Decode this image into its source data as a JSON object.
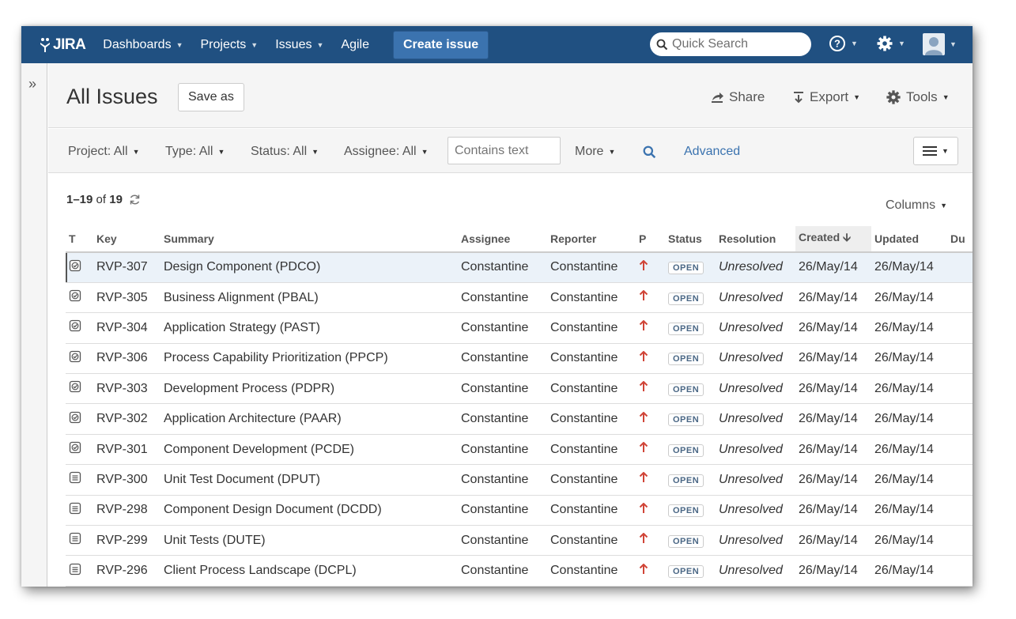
{
  "topnav": {
    "logo": "JIRA",
    "items": [
      "Dashboards",
      "Projects",
      "Issues",
      "Agile"
    ],
    "create_label": "Create issue",
    "search_placeholder": "Quick Search",
    "accent": "#205081"
  },
  "page": {
    "title": "All Issues",
    "save_as": "Save as",
    "share": "Share",
    "export": "Export",
    "tools": "Tools"
  },
  "filters": {
    "project": "Project: All",
    "type": "Type: All",
    "status": "Status: All",
    "assignee": "Assignee: All",
    "contains_placeholder": "Contains text",
    "more": "More",
    "advanced": "Advanced"
  },
  "results": {
    "range": "1–19",
    "of_label": "of",
    "total": "19",
    "columns_label": "Columns"
  },
  "table": {
    "headers": {
      "t": "T",
      "key": "Key",
      "summary": "Summary",
      "assignee": "Assignee",
      "reporter": "Reporter",
      "p": "P",
      "status": "Status",
      "resolution": "Resolution",
      "created": "Created",
      "updated": "Updated",
      "due": "Du"
    },
    "rows": [
      {
        "type": "check-icon",
        "key": "RVP-307",
        "summary": "Design Component (PDCO)",
        "assignee": "Constantine",
        "reporter": "Constantine",
        "status": "OPEN",
        "resolution": "Unresolved",
        "created": "26/May/14",
        "updated": "26/May/14"
      },
      {
        "type": "check-icon",
        "key": "RVP-305",
        "summary": "Business Alignment (PBAL)",
        "assignee": "Constantine",
        "reporter": "Constantine",
        "status": "OPEN",
        "resolution": "Unresolved",
        "created": "26/May/14",
        "updated": "26/May/14"
      },
      {
        "type": "check-icon",
        "key": "RVP-304",
        "summary": "Application Strategy (PAST)",
        "assignee": "Constantine",
        "reporter": "Constantine",
        "status": "OPEN",
        "resolution": "Unresolved",
        "created": "26/May/14",
        "updated": "26/May/14"
      },
      {
        "type": "check-icon",
        "key": "RVP-306",
        "summary": "Process Capability Prioritization (PPCP)",
        "assignee": "Constantine",
        "reporter": "Constantine",
        "status": "OPEN",
        "resolution": "Unresolved",
        "created": "26/May/14",
        "updated": "26/May/14"
      },
      {
        "type": "check-icon",
        "key": "RVP-303",
        "summary": "Development Process (PDPR)",
        "assignee": "Constantine",
        "reporter": "Constantine",
        "status": "OPEN",
        "resolution": "Unresolved",
        "created": "26/May/14",
        "updated": "26/May/14"
      },
      {
        "type": "check-icon",
        "key": "RVP-302",
        "summary": "Application Architecture (PAAR)",
        "assignee": "Constantine",
        "reporter": "Constantine",
        "status": "OPEN",
        "resolution": "Unresolved",
        "created": "26/May/14",
        "updated": "26/May/14"
      },
      {
        "type": "check-icon",
        "key": "RVP-301",
        "summary": "Component Development (PCDE)",
        "assignee": "Constantine",
        "reporter": "Constantine",
        "status": "OPEN",
        "resolution": "Unresolved",
        "created": "26/May/14",
        "updated": "26/May/14"
      },
      {
        "type": "document-icon",
        "key": "RVP-300",
        "summary": "Unit Test Document (DPUT)",
        "assignee": "Constantine",
        "reporter": "Constantine",
        "status": "OPEN",
        "resolution": "Unresolved",
        "created": "26/May/14",
        "updated": "26/May/14"
      },
      {
        "type": "document-icon",
        "key": "RVP-298",
        "summary": "Component Design Document (DCDD)",
        "assignee": "Constantine",
        "reporter": "Constantine",
        "status": "OPEN",
        "resolution": "Unresolved",
        "created": "26/May/14",
        "updated": "26/May/14"
      },
      {
        "type": "document-icon",
        "key": "RVP-299",
        "summary": "Unit Tests (DUTE)",
        "assignee": "Constantine",
        "reporter": "Constantine",
        "status": "OPEN",
        "resolution": "Unresolved",
        "created": "26/May/14",
        "updated": "26/May/14"
      },
      {
        "type": "document-icon",
        "key": "RVP-296",
        "summary": "Client Process Landscape (DCPL)",
        "assignee": "Constantine",
        "reporter": "Constantine",
        "status": "OPEN",
        "resolution": "Unresolved",
        "created": "26/May/14",
        "updated": "26/May/14"
      }
    ]
  }
}
